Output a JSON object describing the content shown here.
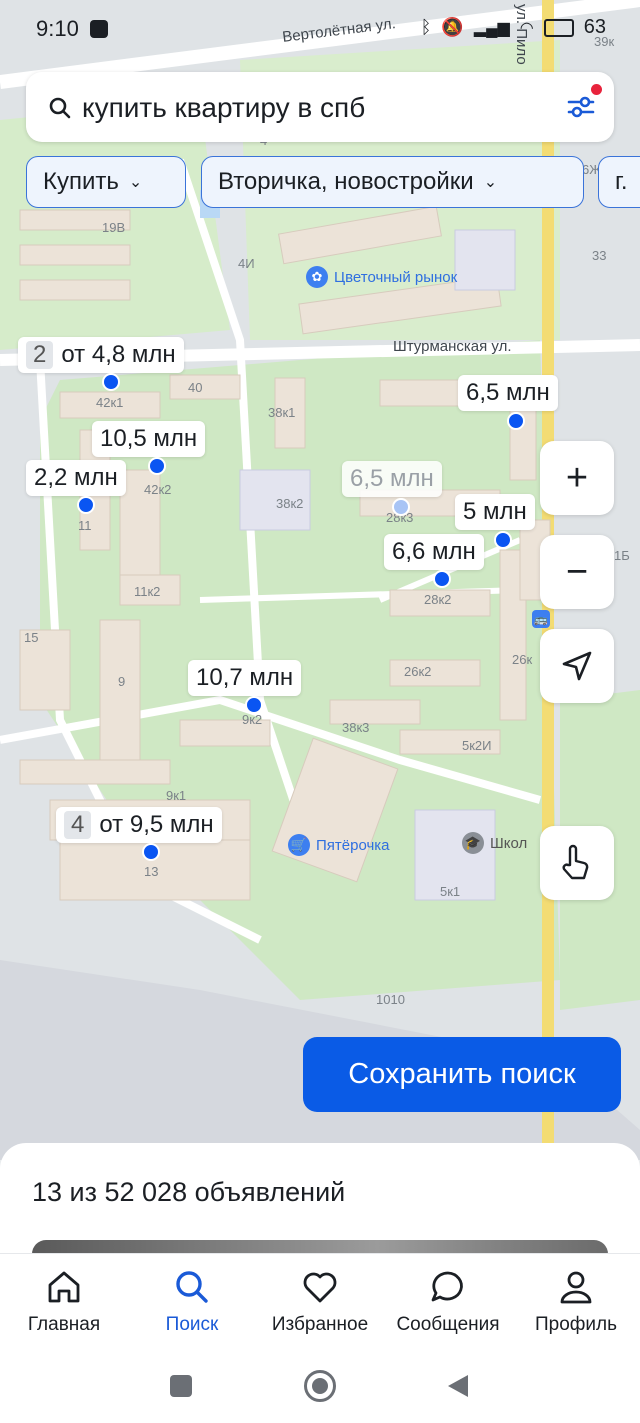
{
  "status_bar": {
    "time": "9:10",
    "battery": "63"
  },
  "search": {
    "query": "купить квартиру в спб"
  },
  "filters": [
    {
      "label": "Купить"
    },
    {
      "label": "Вторичка, новостройки"
    },
    {
      "label": "г."
    }
  ],
  "map": {
    "streets": [
      "Вертолётная ул.",
      "Штурманская ул.",
      "ул. Пило"
    ],
    "pois": [
      {
        "label": "Цветочный рынок"
      },
      {
        "label": "Пятёрочка"
      },
      {
        "label": "Школ"
      }
    ],
    "house_numbers": [
      "19В",
      "4И",
      "33",
      "40",
      "42к1",
      "38к1",
      "42к2",
      "38к2",
      "28к3",
      "11",
      "11к2",
      "28к2",
      "15",
      "9",
      "26к2",
      "26к",
      "9к2",
      "38к3",
      "5к2И",
      "9к1",
      "13",
      "5к1",
      "1010",
      "4",
      "39к",
      "6Ж",
      "1Б"
    ],
    "price_tags": [
      {
        "count": "2",
        "text": "от 4,8 млн"
      },
      {
        "count": "",
        "text": "6,5 млн"
      },
      {
        "count": "",
        "text": "10,5 млн"
      },
      {
        "count": "",
        "text": "2,2 млн"
      },
      {
        "count": "",
        "text": "6,5 млн"
      },
      {
        "count": "",
        "text": "5 млн"
      },
      {
        "count": "",
        "text": "6,6 млн"
      },
      {
        "count": "",
        "text": "10,7 млн"
      },
      {
        "count": "4",
        "text": "от 9,5 млн"
      }
    ]
  },
  "controls": {
    "zoom_in": "+",
    "zoom_out": "−"
  },
  "save_search_label": "Сохранить поиск",
  "results": {
    "count_text": "13 из 52 028 объявлений"
  },
  "tabs": [
    {
      "label": "Главная"
    },
    {
      "label": "Поиск"
    },
    {
      "label": "Избранное"
    },
    {
      "label": "Сообщения"
    },
    {
      "label": "Профиль"
    }
  ],
  "colors": {
    "accent": "#0a5be6",
    "pin": "#0a55f2",
    "active_tab": "#1a5ad7",
    "park": "#cfe8c4"
  }
}
